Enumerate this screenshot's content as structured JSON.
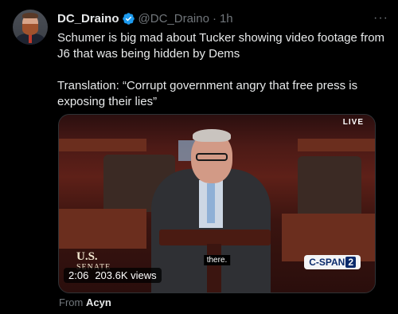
{
  "author": {
    "display_name": "DC_Draino",
    "handle": "@DC_Draino",
    "separator": "·",
    "timestamp": "1h",
    "verified": true,
    "verified_color": "#1d9bf0"
  },
  "more_label": "···",
  "tweet_text": "Schumer is big mad about Tucker showing video footage from J6 that was being hidden by Dems\n\nTranslation: “Corrupt government angry that free press is exposing their lies”",
  "media": {
    "live_label": "LIVE",
    "caption": "there.",
    "senate_logo_line1": "U.S.",
    "senate_logo_line2": "SENATE",
    "network_logo_a": "C-SPAN",
    "network_logo_b": "2",
    "duration": "2:06",
    "views": "203.6K views"
  },
  "attribution": {
    "prefix": "From",
    "source": "Acyn"
  },
  "colors": {
    "background": "#000000",
    "text_primary": "#e7e9ea",
    "text_secondary": "#71767b",
    "verified": "#1d9bf0"
  }
}
